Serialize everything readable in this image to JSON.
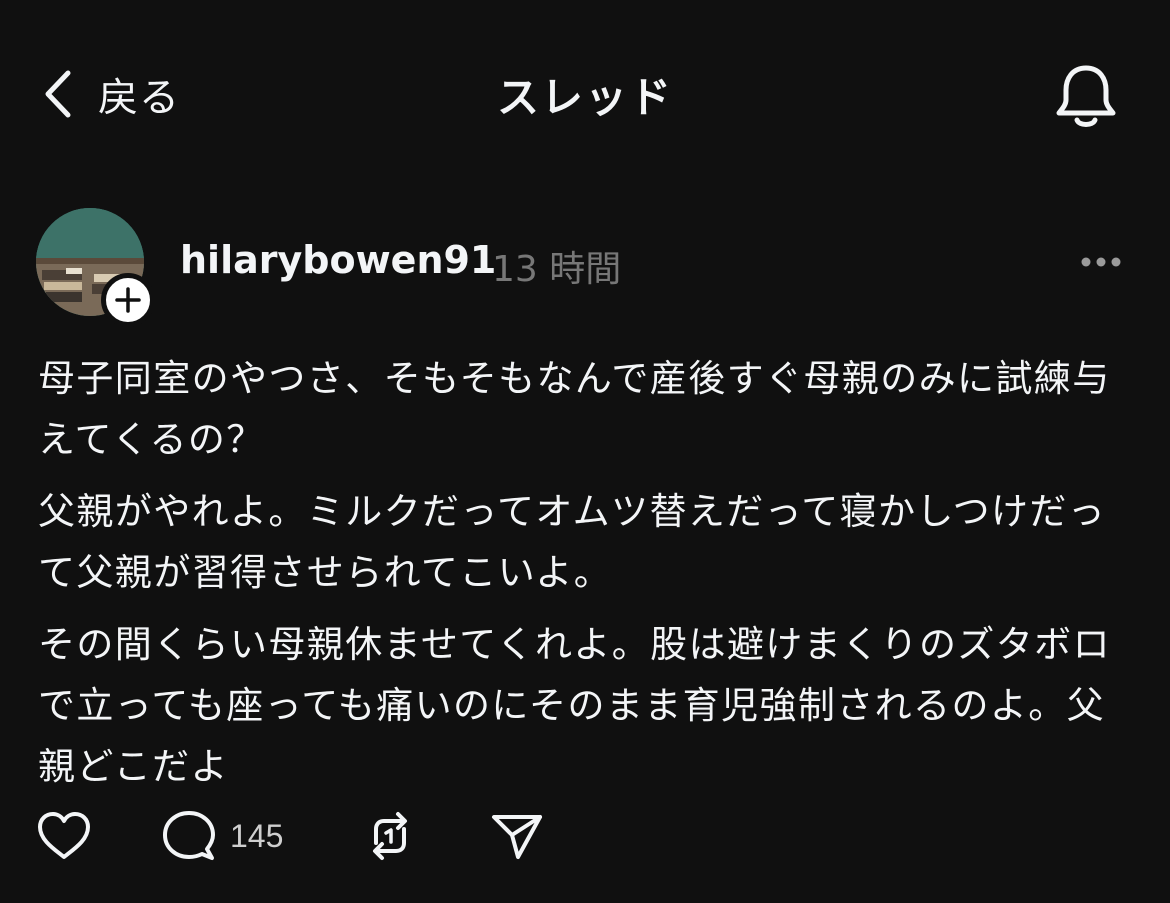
{
  "header": {
    "back_label": "戻る",
    "title": "スレッド",
    "back_icon": "chevron-left-icon",
    "notification_icon": "bell-icon"
  },
  "post": {
    "username": "hilarybowen91",
    "timestamp": "13 時間",
    "avatar_icon": "classroom-avatar",
    "follow_icon": "plus-icon",
    "more_icon": "more-horizontal-icon",
    "paragraphs": [
      "母子同室のやつさ、そもそもなんで産後すぐ母親のみに試練与えてくるの？",
      "父親がやれよ。ミルクだってオムツ替えだって寝かしつけだって父親が習得させられてこいよ。",
      "その間くらい母親休ませてくれよ。股は避けまくりのズタボロで立っても座っても痛いのにそのまま育児強制されるのよ。父親どこだよ"
    ]
  },
  "actions": {
    "like_icon": "heart-icon",
    "reply_icon": "comment-icon",
    "reply_count": "145",
    "repost_icon": "repost-icon",
    "share_icon": "send-icon"
  },
  "colors": {
    "background": "#101010",
    "text": "#f3f5f7",
    "secondary_text": "#777777"
  }
}
